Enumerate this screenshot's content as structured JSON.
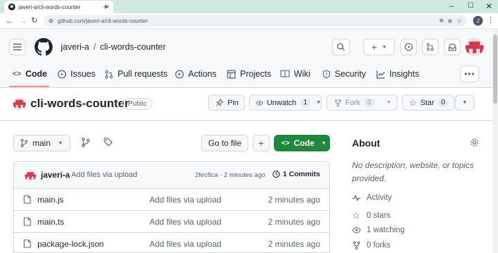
{
  "browser": {
    "tab_title": "javeri-a/cli-words-counter",
    "url": "github.com/javeri-a/cli-words-counter",
    "profile_initial": "J"
  },
  "header": {
    "owner": "javeri-a",
    "separator": "/",
    "repo": "cli-words-counter"
  },
  "nav_tabs": [
    {
      "label": "Code"
    },
    {
      "label": "Issues"
    },
    {
      "label": "Pull requests"
    },
    {
      "label": "Actions"
    },
    {
      "label": "Projects"
    },
    {
      "label": "Wiki"
    },
    {
      "label": "Security"
    },
    {
      "label": "Insights"
    }
  ],
  "repo_header": {
    "name": "cli-words-counter",
    "visibility": "Public",
    "pin_label": "Pin",
    "watch_label": "Unwatch",
    "watch_count": "1",
    "fork_label": "Fork",
    "fork_count": "0",
    "star_label": "Star",
    "star_count": "0"
  },
  "toolbar": {
    "branch": "main",
    "go_to_file": "Go to file",
    "add_label": "+",
    "code_label": "Code"
  },
  "latest_commit": {
    "author": "javeri-a",
    "message": "Add files via upload",
    "meta": "2fec8ca · 2 minutes ago",
    "commits_label": "1 Commits"
  },
  "files": [
    {
      "name": "main.js",
      "message": "Add files via upload",
      "time": "2 minutes ago"
    },
    {
      "name": "main.ts",
      "message": "Add files via upload",
      "time": "2 minutes ago"
    },
    {
      "name": "package-lock.json",
      "message": "Add files via upload",
      "time": "2 minutes ago"
    }
  ],
  "about": {
    "title": "About",
    "description": "No description, website, or topics provided.",
    "activity": "Activity",
    "stars": "0 stars",
    "watching": "1 watching",
    "forks": "0 forks"
  },
  "colors": {
    "accent_green": "#1f883d",
    "tab_underline": "#fd8c73",
    "avatar_red": "#c93a4d"
  }
}
